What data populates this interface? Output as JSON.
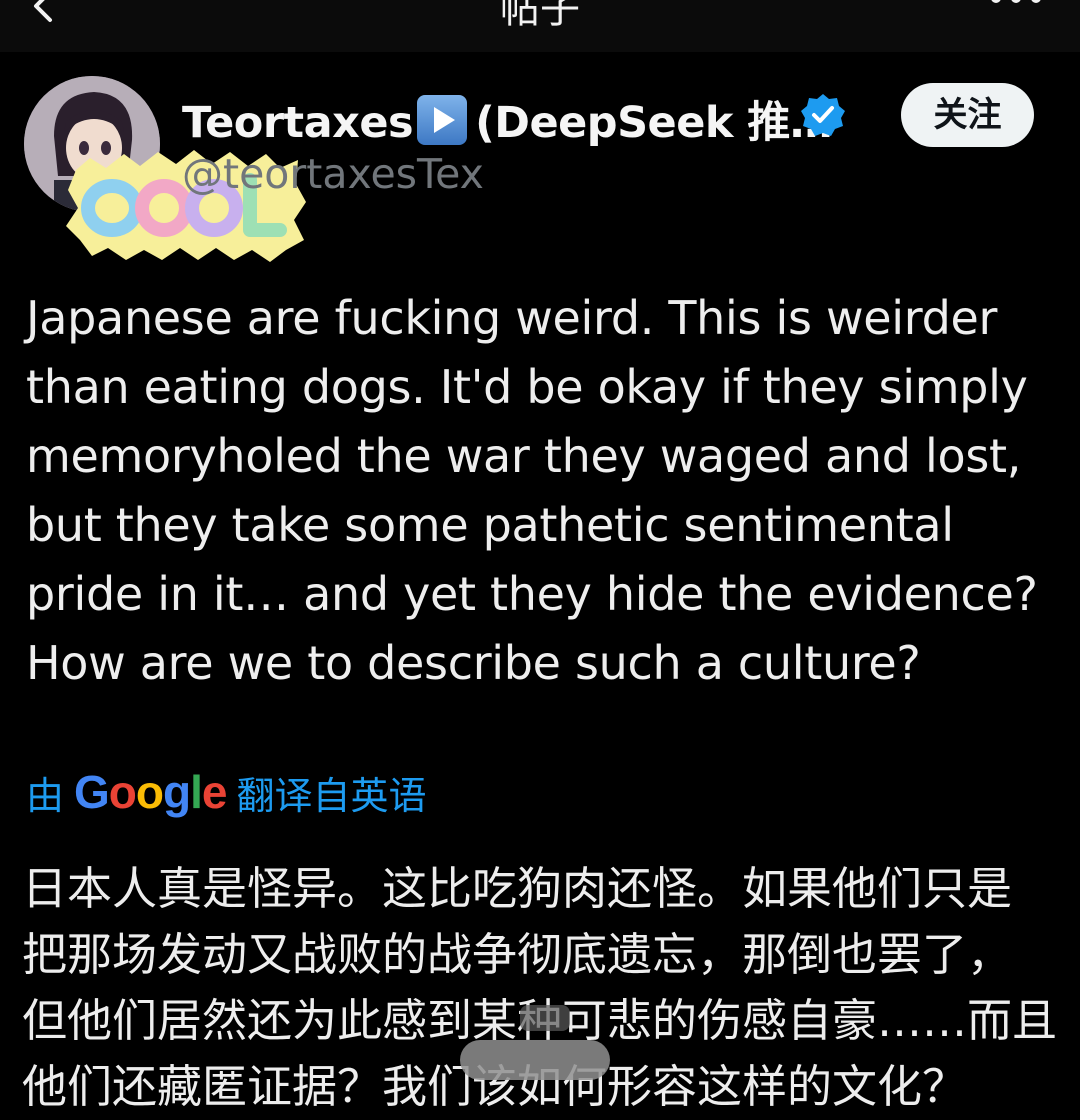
{
  "header": {
    "title": "帖子"
  },
  "author": {
    "display_name": "Teortaxes",
    "display_name_suffix": "(DeepSeek 推…",
    "handle": "@teortaxesTex",
    "follow_label": "关注",
    "sticker_text": "COOL"
  },
  "tweet": {
    "lines": [
      "Japanese are fucking weird. This is weirder",
      "than eating dogs. It'd be okay if they simply",
      "memoryholed the war they waged and lost,",
      "but they take some pathetic sentimental",
      "pride in it… and yet they hide the evidence?",
      "How are we to describe such a culture?"
    ]
  },
  "translation": {
    "by": "由",
    "provider": "Google",
    "from": "翻译自英语",
    "lines": [
      "日本人真是怪异。这比吃狗肉还怪。如果他们只是",
      "把那场发动又战败的战争彻底遗忘，那倒也罢了，",
      "但他们居然还为此感到某种可悲的伤感自豪……而且",
      "他们还藏匿证据？我们该如何形容这样的文化？"
    ]
  },
  "colors": {
    "background": "#000000",
    "link": "#1d9bf0",
    "verified": "#1d9bf0",
    "handle": "#71767b"
  }
}
